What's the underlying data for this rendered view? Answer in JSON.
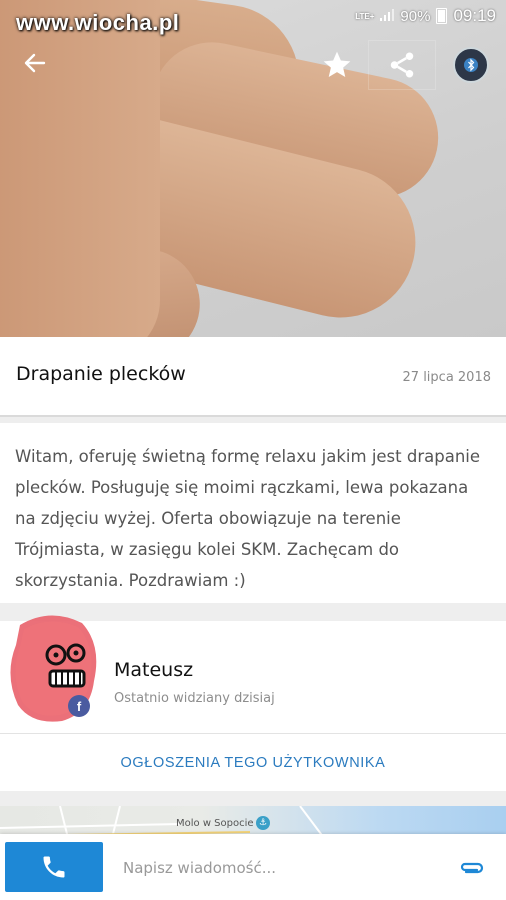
{
  "status_bar": {
    "watermark": "www.wiocha.pl",
    "network": "LTE+",
    "battery": "90%",
    "time": "09:19"
  },
  "toolbar": {
    "back_icon": "arrow-left-icon",
    "favorite_icon": "star-icon",
    "share_icon": "share-icon",
    "bluetooth_icon": "bluetooth-icon"
  },
  "ad": {
    "title": "Drapanie plecków",
    "date": "27 lipca 2018",
    "description": "Witam, oferuję świetną formę relaxu jakim jest drapanie plecków. Posługuję się moimi rączkami, lewa pokazana na zdjęciu wyżej. Oferta obowiązuje na terenie Trójmiasta, w zasięgu kolei SKM. Zachęcam do skorzystania. Pozdrawiam :)"
  },
  "user": {
    "name": "Mateusz",
    "last_seen": "Ostatnio widziany dzisiaj",
    "ads_link": "OGŁOSZENIA TEGO UŻYTKOWNIKA"
  },
  "map": {
    "label": "Molo w Sopocie"
  },
  "bottom_bar": {
    "message_placeholder": "Napisz wiadomość...",
    "call_icon": "phone-icon",
    "attach_icon": "paperclip-icon"
  },
  "colors": {
    "accent": "#1e88d6",
    "link": "#2b7bbf"
  }
}
